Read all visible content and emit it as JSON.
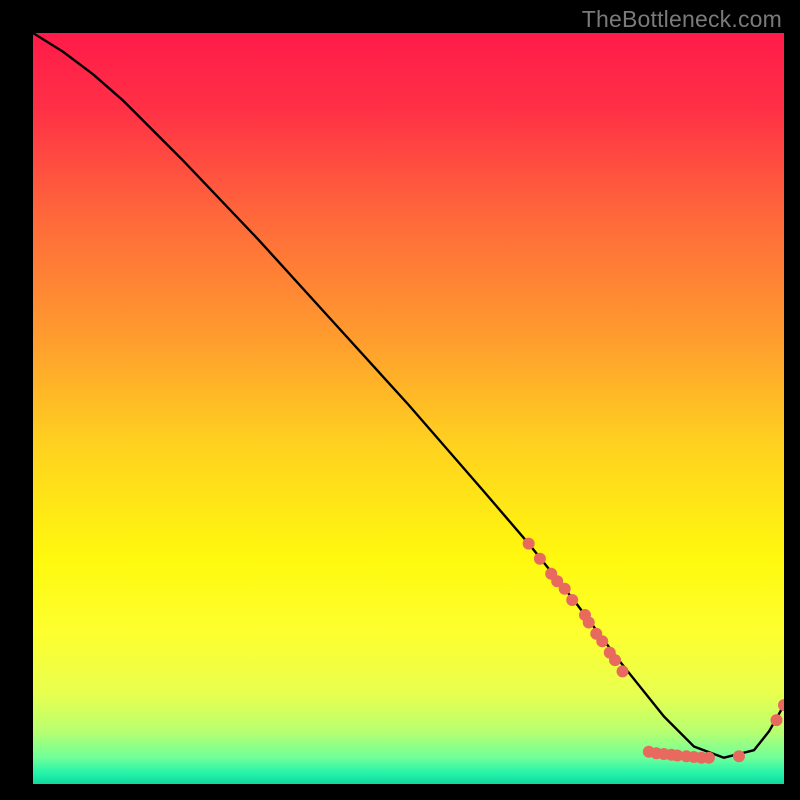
{
  "watermark": "TheBottleneck.com",
  "chart_data": {
    "type": "line",
    "title": "",
    "xlabel": "",
    "ylabel": "",
    "xlim": [
      0,
      100
    ],
    "ylim": [
      0,
      100
    ],
    "background_gradient": {
      "stops": [
        {
          "offset": 0.0,
          "color": "#ff1b49"
        },
        {
          "offset": 0.1,
          "color": "#ff3046"
        },
        {
          "offset": 0.25,
          "color": "#ff6a3a"
        },
        {
          "offset": 0.4,
          "color": "#ff9a2f"
        },
        {
          "offset": 0.55,
          "color": "#ffd21f"
        },
        {
          "offset": 0.7,
          "color": "#fff90e"
        },
        {
          "offset": 0.8,
          "color": "#fdff2f"
        },
        {
          "offset": 0.88,
          "color": "#e8ff4f"
        },
        {
          "offset": 0.93,
          "color": "#b8ff70"
        },
        {
          "offset": 0.965,
          "color": "#6fff9a"
        },
        {
          "offset": 0.985,
          "color": "#26f4a9"
        },
        {
          "offset": 1.0,
          "color": "#10d89e"
        }
      ]
    },
    "series": [
      {
        "name": "bottleneck-curve",
        "x": [
          0.0,
          4.0,
          8.0,
          12.0,
          16.0,
          20.0,
          30.0,
          40.0,
          50.0,
          60.0,
          66.0,
          72.0,
          78.0,
          84.0,
          88.0,
          92.0,
          96.0,
          98.0,
          100.0
        ],
        "y": [
          100.0,
          97.5,
          94.5,
          91.0,
          87.0,
          83.0,
          72.5,
          61.5,
          50.5,
          39.0,
          32.0,
          24.5,
          16.5,
          9.0,
          5.0,
          3.5,
          4.5,
          7.0,
          10.5
        ]
      }
    ],
    "scatter": [
      {
        "name": "curve-markers",
        "color": "#e86a5e",
        "r": 6,
        "points": [
          {
            "x": 66.0,
            "y": 32.0
          },
          {
            "x": 67.5,
            "y": 30.0
          },
          {
            "x": 69.0,
            "y": 28.0
          },
          {
            "x": 69.8,
            "y": 27.0
          },
          {
            "x": 70.8,
            "y": 26.0
          },
          {
            "x": 71.8,
            "y": 24.5
          },
          {
            "x": 73.5,
            "y": 22.5
          },
          {
            "x": 74.0,
            "y": 21.5
          },
          {
            "x": 75.0,
            "y": 20.0
          },
          {
            "x": 75.8,
            "y": 19.0
          },
          {
            "x": 76.8,
            "y": 17.5
          },
          {
            "x": 77.5,
            "y": 16.5
          },
          {
            "x": 78.5,
            "y": 15.0
          },
          {
            "x": 82.0,
            "y": 4.3
          },
          {
            "x": 83.0,
            "y": 4.1
          },
          {
            "x": 84.0,
            "y": 4.0
          },
          {
            "x": 85.0,
            "y": 3.9
          },
          {
            "x": 85.8,
            "y": 3.8
          },
          {
            "x": 87.0,
            "y": 3.7
          },
          {
            "x": 88.0,
            "y": 3.6
          },
          {
            "x": 89.0,
            "y": 3.5
          },
          {
            "x": 90.0,
            "y": 3.5
          },
          {
            "x": 94.0,
            "y": 3.7
          },
          {
            "x": 99.0,
            "y": 8.5
          },
          {
            "x": 100.0,
            "y": 10.5
          }
        ]
      }
    ]
  }
}
